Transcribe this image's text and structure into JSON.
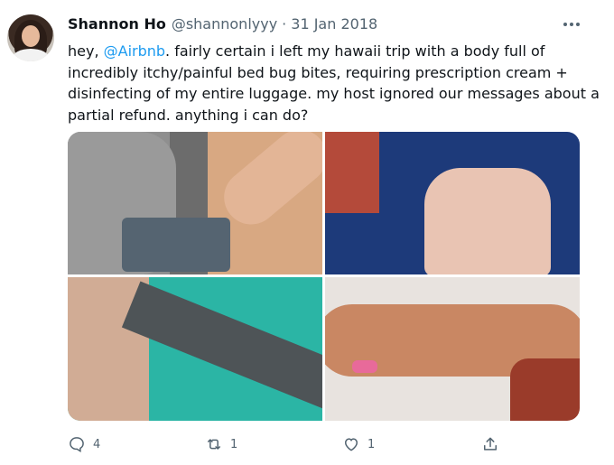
{
  "tweet": {
    "name": "Shannon Ho",
    "handle": "@shannonlyyy",
    "separator": "·",
    "date": "31 Jan 2018",
    "text_before": "hey, ",
    "mention": "@Airbnb",
    "text_after": ". fairly certain i left my hawaii trip with a body full of incredibly itchy/painful bed bug bites, requiring prescription cream + disinfecting of my entire luggage. my host ignored our messages about a partial refund. anything i can do?",
    "reply_count": "4",
    "retweet_count": "1",
    "like_count": "1"
  },
  "icons": {
    "more": "more-options-icon",
    "reply": "reply-icon",
    "retweet": "retweet-icon",
    "like": "heart-icon",
    "share": "share-icon"
  },
  "colors": {
    "link": "#1d9bf0",
    "secondary_text": "#536471",
    "primary_text": "#0f1419"
  }
}
